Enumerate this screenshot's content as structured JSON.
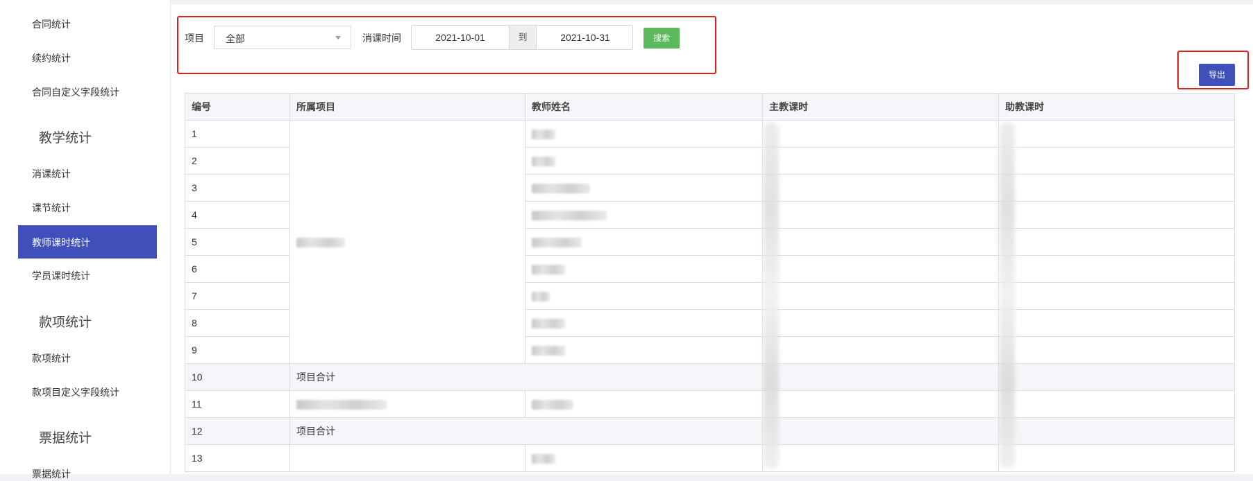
{
  "sidebar": {
    "items_top": [
      "合同统计",
      "续约统计",
      "合同自定义字段统计"
    ],
    "section_teaching": "教学统计",
    "items_teaching": [
      "消课统计",
      "课节统计",
      "教师课时统计",
      "学员课时统计"
    ],
    "active_item": "教师课时统计",
    "section_payment": "款项统计",
    "items_payment": [
      "款项统计",
      "款项目定义字段统计"
    ],
    "section_invoice": "票据统计",
    "items_invoice": [
      "票据统计"
    ]
  },
  "filters": {
    "project_label": "项目",
    "project_value": "全部",
    "time_label": "消课时间",
    "date_from": "2021-10-01",
    "date_sep": "到",
    "date_to": "2021-10-31",
    "search_label": "搜索"
  },
  "toolbar": {
    "export_label": "导出"
  },
  "table": {
    "headers": [
      "编号",
      "所属项目",
      "教师姓名",
      "主教课时",
      "助教课时"
    ],
    "rows": [
      {
        "no": "1",
        "project": "",
        "teacher": "",
        "sub": false
      },
      {
        "no": "2",
        "project": "",
        "teacher": "",
        "sub": false
      },
      {
        "no": "3",
        "project": "",
        "teacher": "",
        "sub": false
      },
      {
        "no": "4",
        "project": "",
        "teacher": "",
        "sub": false
      },
      {
        "no": "5",
        "project": "",
        "teacher": "",
        "sub": false
      },
      {
        "no": "6",
        "project": "",
        "teacher": "",
        "sub": false
      },
      {
        "no": "7",
        "project": "",
        "teacher": "",
        "sub": false
      },
      {
        "no": "8",
        "project": "",
        "teacher": "",
        "sub": false
      },
      {
        "no": "9",
        "project": "",
        "teacher": "",
        "sub": false
      },
      {
        "no": "10",
        "project": "项目合计",
        "teacher": "",
        "sub": true
      },
      {
        "no": "11",
        "project": "",
        "teacher": "",
        "sub": false
      },
      {
        "no": "12",
        "project": "项目合计",
        "teacher": "",
        "sub": true
      },
      {
        "no": "13",
        "project": "",
        "teacher": "",
        "sub": false
      }
    ]
  },
  "colors": {
    "accent": "#4050bb",
    "search_button": "#5cb85c",
    "highlight_box": "#e01e1e"
  }
}
